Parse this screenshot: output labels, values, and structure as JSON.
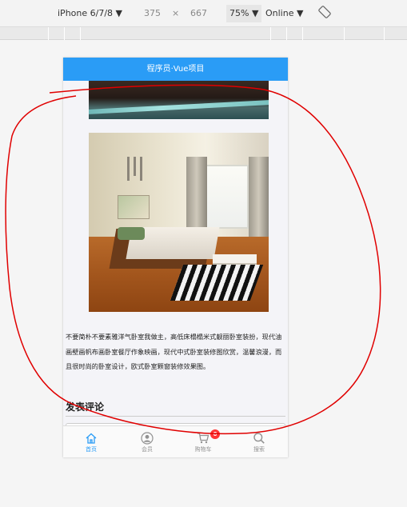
{
  "devtools": {
    "device": "iPhone 6/7/8 ▼",
    "width": "375",
    "times": "×",
    "height": "667",
    "zoom": "75% ▼",
    "network": "Online ▼"
  },
  "app": {
    "title": "程序员·Vue项目"
  },
  "article": {
    "description": "不要简朴不要素雅洋气卧室我做主，高低床榻榻米式靓丽卧室装扮，现代油画壁画帆布画卧室餐厅作象映画，现代中式卧室装修图欣赏，温馨浪漫，而且很时尚的卧室设计，欧式卧室颗窗装修效果图。"
  },
  "comments": {
    "title": "发表评论"
  },
  "tabbar": {
    "items": [
      {
        "label": "首页",
        "icon": "home-icon",
        "active": true
      },
      {
        "label": "会员",
        "icon": "user-icon",
        "active": false
      },
      {
        "label": "购物车",
        "icon": "cart-icon",
        "active": false,
        "badge": "0"
      },
      {
        "label": "搜索",
        "icon": "search-icon",
        "active": false
      }
    ]
  },
  "colors": {
    "accent": "#2a9cf6",
    "badge": "#ff3333",
    "annotation": "#e00000"
  }
}
